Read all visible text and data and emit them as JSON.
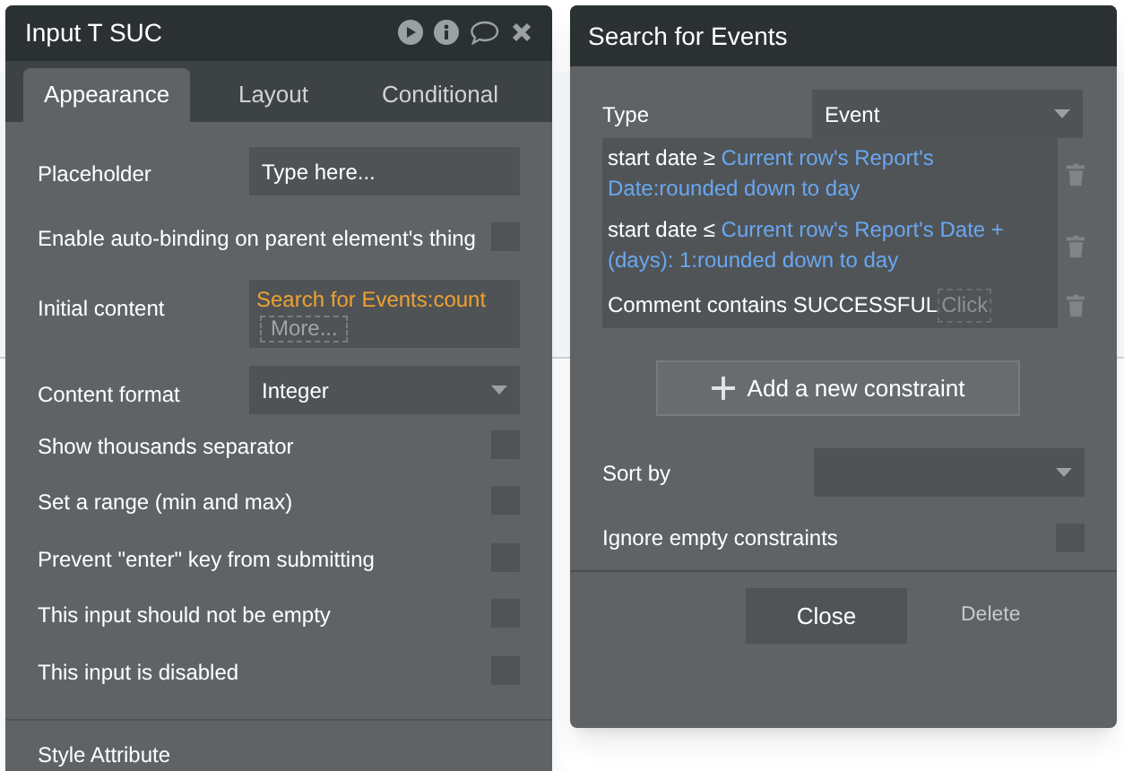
{
  "element_panel": {
    "title": "Input T SUC",
    "tabs": [
      {
        "label": "Appearance",
        "selected": true
      },
      {
        "label": "Layout",
        "selected": false
      },
      {
        "label": "Conditional",
        "selected": false
      }
    ],
    "fields": [
      {
        "kind": "input",
        "label": "Placeholder",
        "value": "Type here..."
      },
      {
        "kind": "checkbox",
        "label": "Enable auto-binding on parent element's thing",
        "checked": false
      },
      {
        "kind": "expression",
        "label": "Initial content",
        "value": "Search for Events:count",
        "more": "More..."
      },
      {
        "kind": "dropdown",
        "label": "Content format",
        "value": "Integer"
      },
      {
        "kind": "checkbox",
        "label": "Show thousands separator",
        "checked": false
      },
      {
        "kind": "checkbox",
        "label": "Set a range (min and max)",
        "checked": false
      },
      {
        "kind": "checkbox",
        "label": "Prevent \"enter\" key from submitting",
        "checked": false
      },
      {
        "kind": "checkbox",
        "label": "This input should not be empty",
        "checked": false
      },
      {
        "kind": "checkbox",
        "label": "This input is disabled",
        "checked": false
      }
    ],
    "section_heading": "Style Attribute"
  },
  "search_panel": {
    "title": "Search for Events",
    "type_label": "Type",
    "type_value": "Event",
    "constraints": [
      {
        "field": "start date ≥",
        "value": "Current row's Report's Date:rounded down to day"
      },
      {
        "field": "start date ≤",
        "value": "Current row's Report's Date +(days): 1:rounded down to day"
      },
      {
        "field": "Comment contains",
        "value": "SUCCESSFUL",
        "hint": "Click"
      }
    ],
    "add_button": "Add a new constraint",
    "sort_label": "Sort by",
    "ignore_label": "Ignore empty constraints",
    "ignore_checked": false,
    "close_button": "Close",
    "delete_button": "Delete"
  }
}
